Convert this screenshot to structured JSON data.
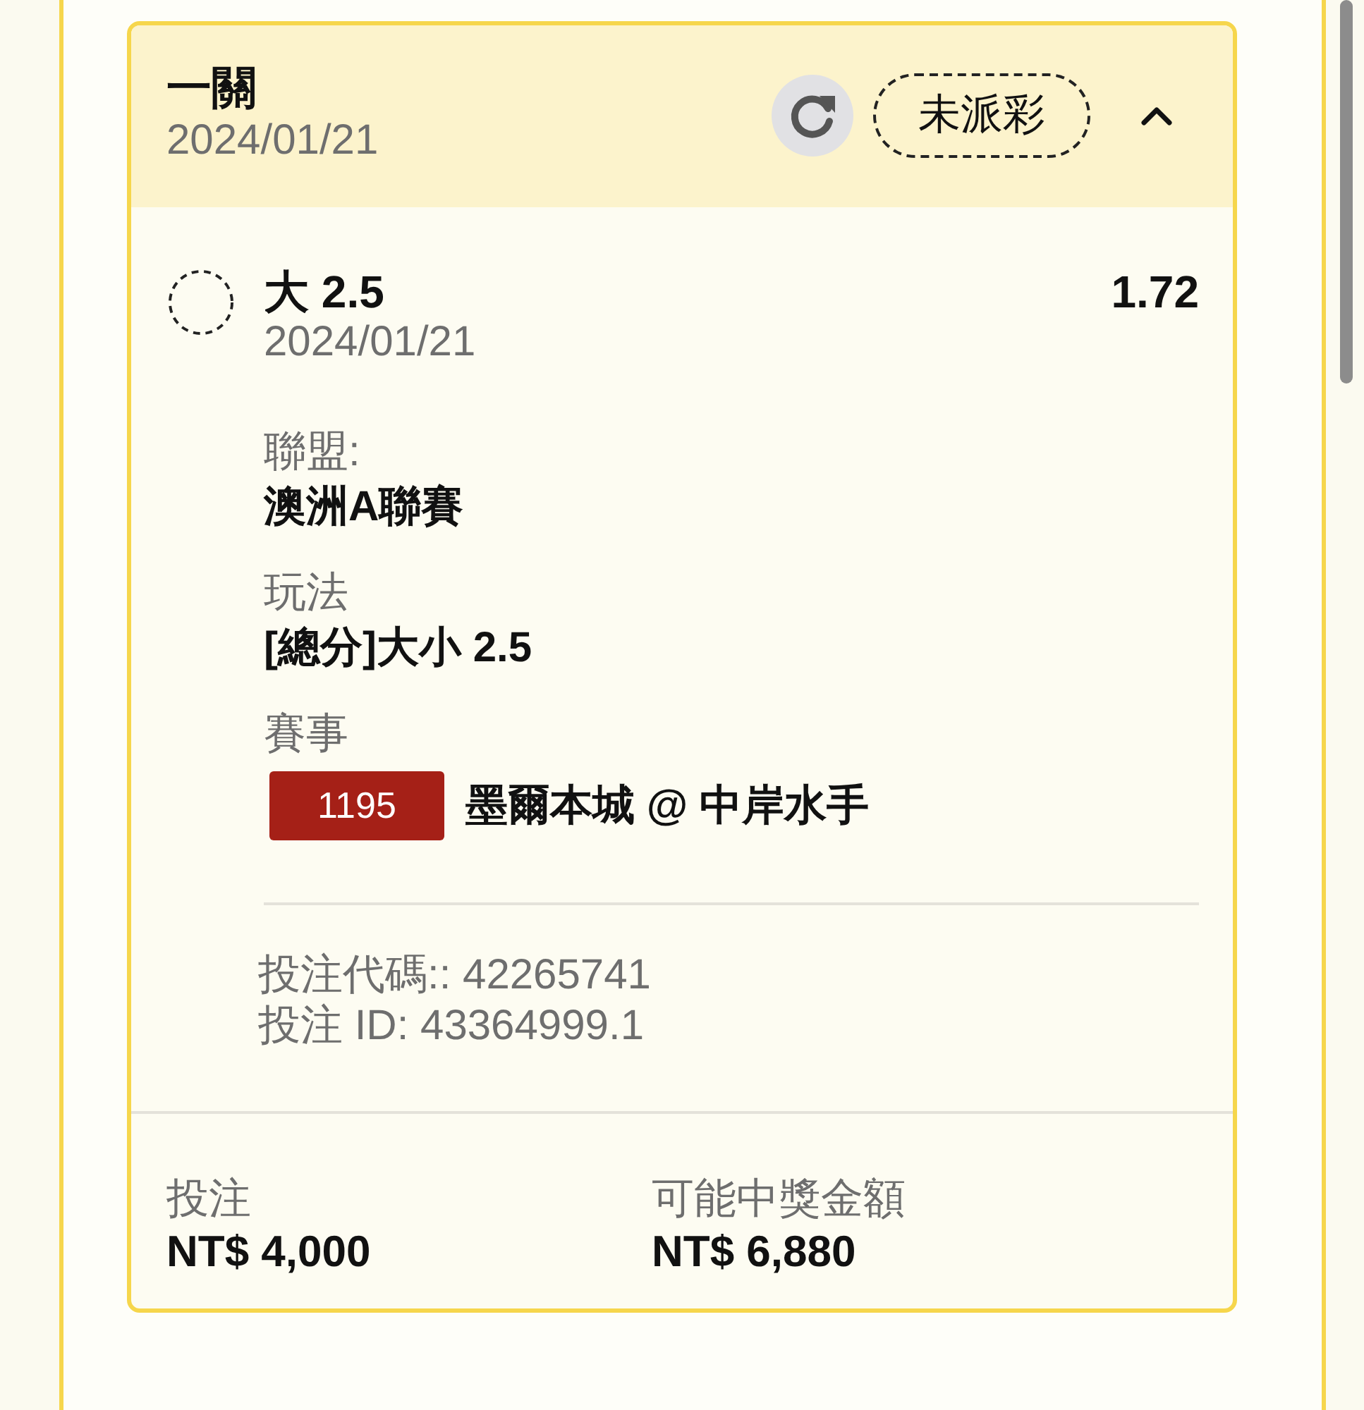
{
  "bet": {
    "title": "一關",
    "date": "2024/01/21",
    "status": "未派彩",
    "expanded": true
  },
  "selection": {
    "name": "大 2.5",
    "odds": "1.72",
    "date": "2024/01/21"
  },
  "details": [
    {
      "kind": "text",
      "label": "聯盟:",
      "value": "澳洲A聯賽"
    },
    {
      "kind": "text",
      "label": "玩法",
      "value": "[總分]大小 2.5"
    },
    {
      "kind": "match",
      "label": "賽事",
      "badge": "1195",
      "value": "墨爾本城 @ 中岸水手"
    }
  ],
  "references": [
    "投注代碼:: 42265741",
    "投注 ID: 43364999.1"
  ],
  "summary": [
    {
      "label": "投注",
      "value": "NT$ 4,000"
    },
    {
      "label": "可能中獎金額",
      "value": "NT$ 6,880"
    }
  ]
}
